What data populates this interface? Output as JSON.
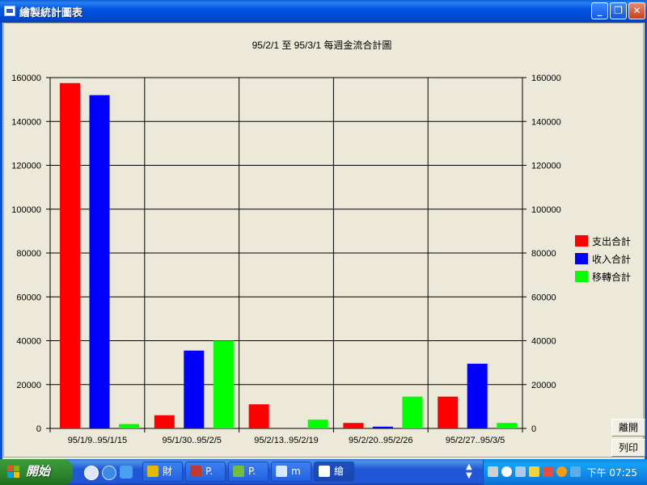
{
  "window": {
    "title": "繪製統計圖表"
  },
  "buttons": {
    "leave": "離開",
    "print": "列印"
  },
  "chart_data": {
    "type": "bar",
    "title": "95/2/1 至 95/3/1 每週金流合計圖",
    "categories": [
      "95/1/9..95/1/15",
      "95/1/30..95/2/5",
      "95/2/13..95/2/19",
      "95/2/20..95/2/26",
      "95/2/27..95/3/5"
    ],
    "series": [
      {
        "name": "支出合計",
        "color": "#ff0000",
        "values": [
          157500,
          6000,
          11000,
          2500,
          14500
        ]
      },
      {
        "name": "收入合計",
        "color": "#0000ff",
        "values": [
          152000,
          35500,
          0,
          800,
          29500
        ]
      },
      {
        "name": "移轉合計",
        "color": "#00ff00",
        "values": [
          2000,
          40000,
          4000,
          14500,
          2500
        ]
      }
    ],
    "yticks": [
      "0",
      "20000",
      "40000",
      "60000",
      "80000",
      "100000",
      "120000",
      "140000",
      "160000"
    ],
    "ylim": [
      0,
      160000
    ],
    "grid": true,
    "legend": "right"
  },
  "taskbar": {
    "start_label": "開始",
    "tasks": [
      {
        "label": "財"
      },
      {
        "label": "P."
      },
      {
        "label": "P."
      },
      {
        "label": "m"
      },
      {
        "label": "繪"
      }
    ],
    "clock": "下午 07:25"
  }
}
